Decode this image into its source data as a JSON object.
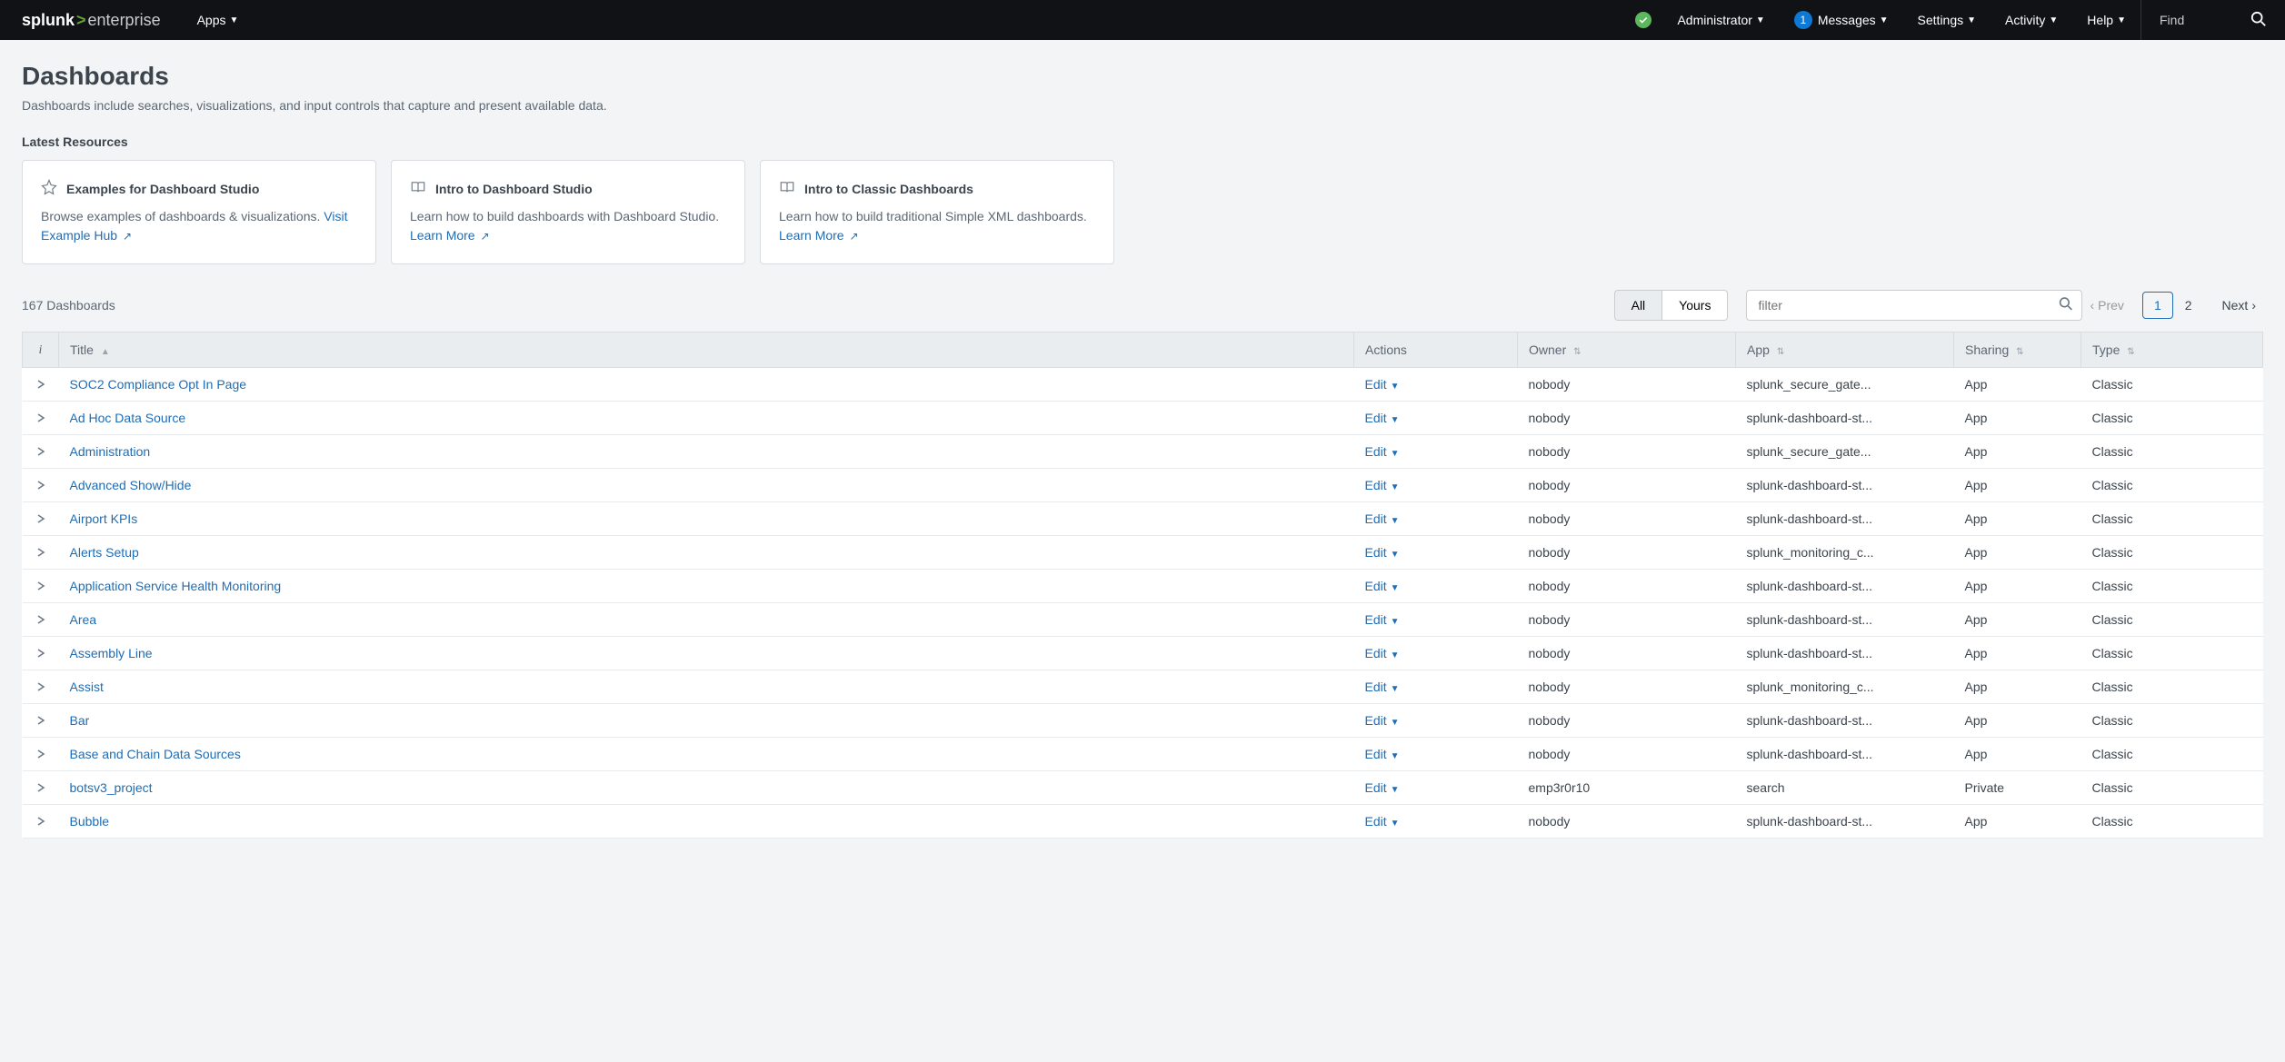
{
  "brand": {
    "a": "splunk",
    "b": "enterprise"
  },
  "topnav": {
    "apps": "Apps",
    "admin": "Administrator",
    "messages": "Messages",
    "messages_badge": "1",
    "settings": "Settings",
    "activity": "Activity",
    "help": "Help",
    "find_placeholder": "Find"
  },
  "page": {
    "title": "Dashboards",
    "subtitle": "Dashboards include searches, visualizations, and input controls that capture and present available data.",
    "latest_label": "Latest Resources"
  },
  "cards": [
    {
      "title": "Examples for Dashboard Studio",
      "body": "Browse examples of dashboards & visualizations. ",
      "link": "Visit Example Hub",
      "icon": "star"
    },
    {
      "title": "Intro to Dashboard Studio",
      "body": "Learn how to build dashboards with Dashboard Studio. ",
      "link": "Learn More",
      "icon": "book"
    },
    {
      "title": "Intro to Classic Dashboards",
      "body": "Learn how to build traditional Simple XML dashboards. ",
      "link": "Learn More",
      "icon": "book"
    }
  ],
  "toolbar": {
    "count": "167 Dashboards",
    "all": "All",
    "yours": "Yours",
    "filter_placeholder": "filter",
    "prev": "Prev",
    "next": "Next",
    "pages": [
      "1",
      "2"
    ],
    "current_page": "1"
  },
  "columns": {
    "info": "i",
    "title": "Title",
    "actions": "Actions",
    "owner": "Owner",
    "app": "App",
    "sharing": "Sharing",
    "type": "Type"
  },
  "edit_label": "Edit",
  "rows": [
    {
      "title": "SOC2 Compliance Opt In Page",
      "owner": "nobody",
      "app": "splunk_secure_gate...",
      "sharing": "App",
      "type": "Classic"
    },
    {
      "title": "Ad Hoc Data Source",
      "owner": "nobody",
      "app": "splunk-dashboard-st...",
      "sharing": "App",
      "type": "Classic"
    },
    {
      "title": "Administration",
      "owner": "nobody",
      "app": "splunk_secure_gate...",
      "sharing": "App",
      "type": "Classic"
    },
    {
      "title": "Advanced Show/Hide",
      "owner": "nobody",
      "app": "splunk-dashboard-st...",
      "sharing": "App",
      "type": "Classic"
    },
    {
      "title": "Airport KPIs",
      "owner": "nobody",
      "app": "splunk-dashboard-st...",
      "sharing": "App",
      "type": "Classic"
    },
    {
      "title": "Alerts Setup",
      "owner": "nobody",
      "app": "splunk_monitoring_c...",
      "sharing": "App",
      "type": "Classic"
    },
    {
      "title": "Application Service Health Monitoring",
      "owner": "nobody",
      "app": "splunk-dashboard-st...",
      "sharing": "App",
      "type": "Classic"
    },
    {
      "title": "Area",
      "owner": "nobody",
      "app": "splunk-dashboard-st...",
      "sharing": "App",
      "type": "Classic"
    },
    {
      "title": "Assembly Line",
      "owner": "nobody",
      "app": "splunk-dashboard-st...",
      "sharing": "App",
      "type": "Classic"
    },
    {
      "title": "Assist",
      "owner": "nobody",
      "app": "splunk_monitoring_c...",
      "sharing": "App",
      "type": "Classic"
    },
    {
      "title": "Bar",
      "owner": "nobody",
      "app": "splunk-dashboard-st...",
      "sharing": "App",
      "type": "Classic"
    },
    {
      "title": "Base and Chain Data Sources",
      "owner": "nobody",
      "app": "splunk-dashboard-st...",
      "sharing": "App",
      "type": "Classic"
    },
    {
      "title": "botsv3_project",
      "owner": "emp3r0r10",
      "app": "search",
      "sharing": "Private",
      "type": "Classic"
    },
    {
      "title": "Bubble",
      "owner": "nobody",
      "app": "splunk-dashboard-st...",
      "sharing": "App",
      "type": "Classic"
    }
  ]
}
